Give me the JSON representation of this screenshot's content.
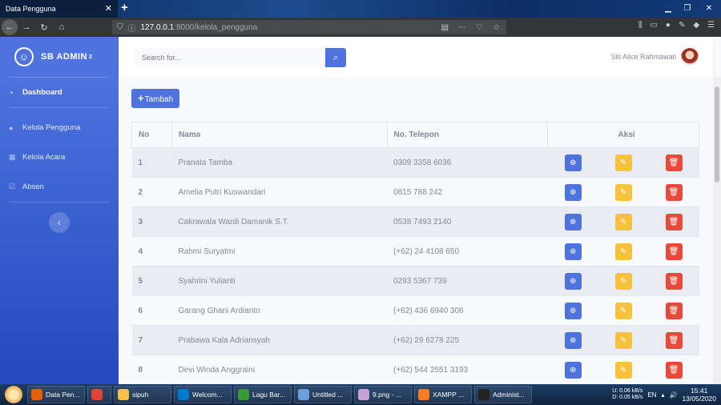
{
  "browser": {
    "tab_title": "Data Pengguna",
    "tab_close": "✕",
    "new_tab": "+",
    "url_host": "127.0.0.1",
    "url_path": ":8000/kelola_pengguna"
  },
  "sidebar": {
    "brand": "SB ADMIN",
    "brand_sup": "2",
    "items": [
      {
        "label": "Dashboard",
        "icon": "dashboard-icon"
      },
      {
        "label": "Kelola Pengguna",
        "icon": "user-icon"
      },
      {
        "label": "Kelola Acara",
        "icon": "calendar-icon"
      },
      {
        "label": "Absen",
        "icon": "check-square-icon"
      }
    ],
    "toggle": "‹"
  },
  "topbar": {
    "search_placeholder": "Search for...",
    "user_name": "Siti Alice Rahmawati"
  },
  "content": {
    "add_button": "Tambah",
    "table": {
      "headers": [
        "No",
        "Nama",
        "No. Telepon",
        "Aksi"
      ],
      "rows": [
        {
          "no": "1",
          "nama": "Pranata Tamba",
          "telepon": "0309 3358 6036"
        },
        {
          "no": "2",
          "nama": "Amelia Putri Kuswandari",
          "telepon": "0815 788 242"
        },
        {
          "no": "3",
          "nama": "Cakrawala Wardi Damanik S.T.",
          "telepon": "0538 7493 2140"
        },
        {
          "no": "4",
          "nama": "Rahmi Suryatmi",
          "telepon": "(+62) 24 4108 650"
        },
        {
          "no": "5",
          "nama": "Syahrini Yulianti",
          "telepon": "0293 5367 739"
        },
        {
          "no": "6",
          "nama": "Garang Ghani Ardianto",
          "telepon": "(+62) 436 6940 306"
        },
        {
          "no": "7",
          "nama": "Prabawa Kala Adriansyah",
          "telepon": "(+62) 29 6278 225"
        },
        {
          "no": "8",
          "nama": "Devi Winda Anggraini",
          "telepon": "(+62) 544 2551 3193"
        }
      ]
    }
  },
  "taskbar": {
    "items": [
      {
        "label": "Data Pen...",
        "color": "#e66000"
      },
      {
        "label": "",
        "color": "#db4437"
      },
      {
        "label": "sipuh",
        "color": "#f2c14e"
      },
      {
        "label": "Welcom...",
        "color": "#007acc"
      },
      {
        "label": "Lagu Bar...",
        "color": "#3a9a3a"
      },
      {
        "label": "Untitled ...",
        "color": "#6aa0d8"
      },
      {
        "label": "9.png - ...",
        "color": "#c9a0dc"
      },
      {
        "label": "XAMPP ...",
        "color": "#fb7a24"
      },
      {
        "label": "Administ...",
        "color": "#222222"
      }
    ],
    "net_up": "0.06 kB/s",
    "net_down": "0.05 kB/s",
    "net_u": "U:",
    "net_d": "D:",
    "lang": "EN",
    "time": "15:41",
    "date": "13/05/2020"
  }
}
